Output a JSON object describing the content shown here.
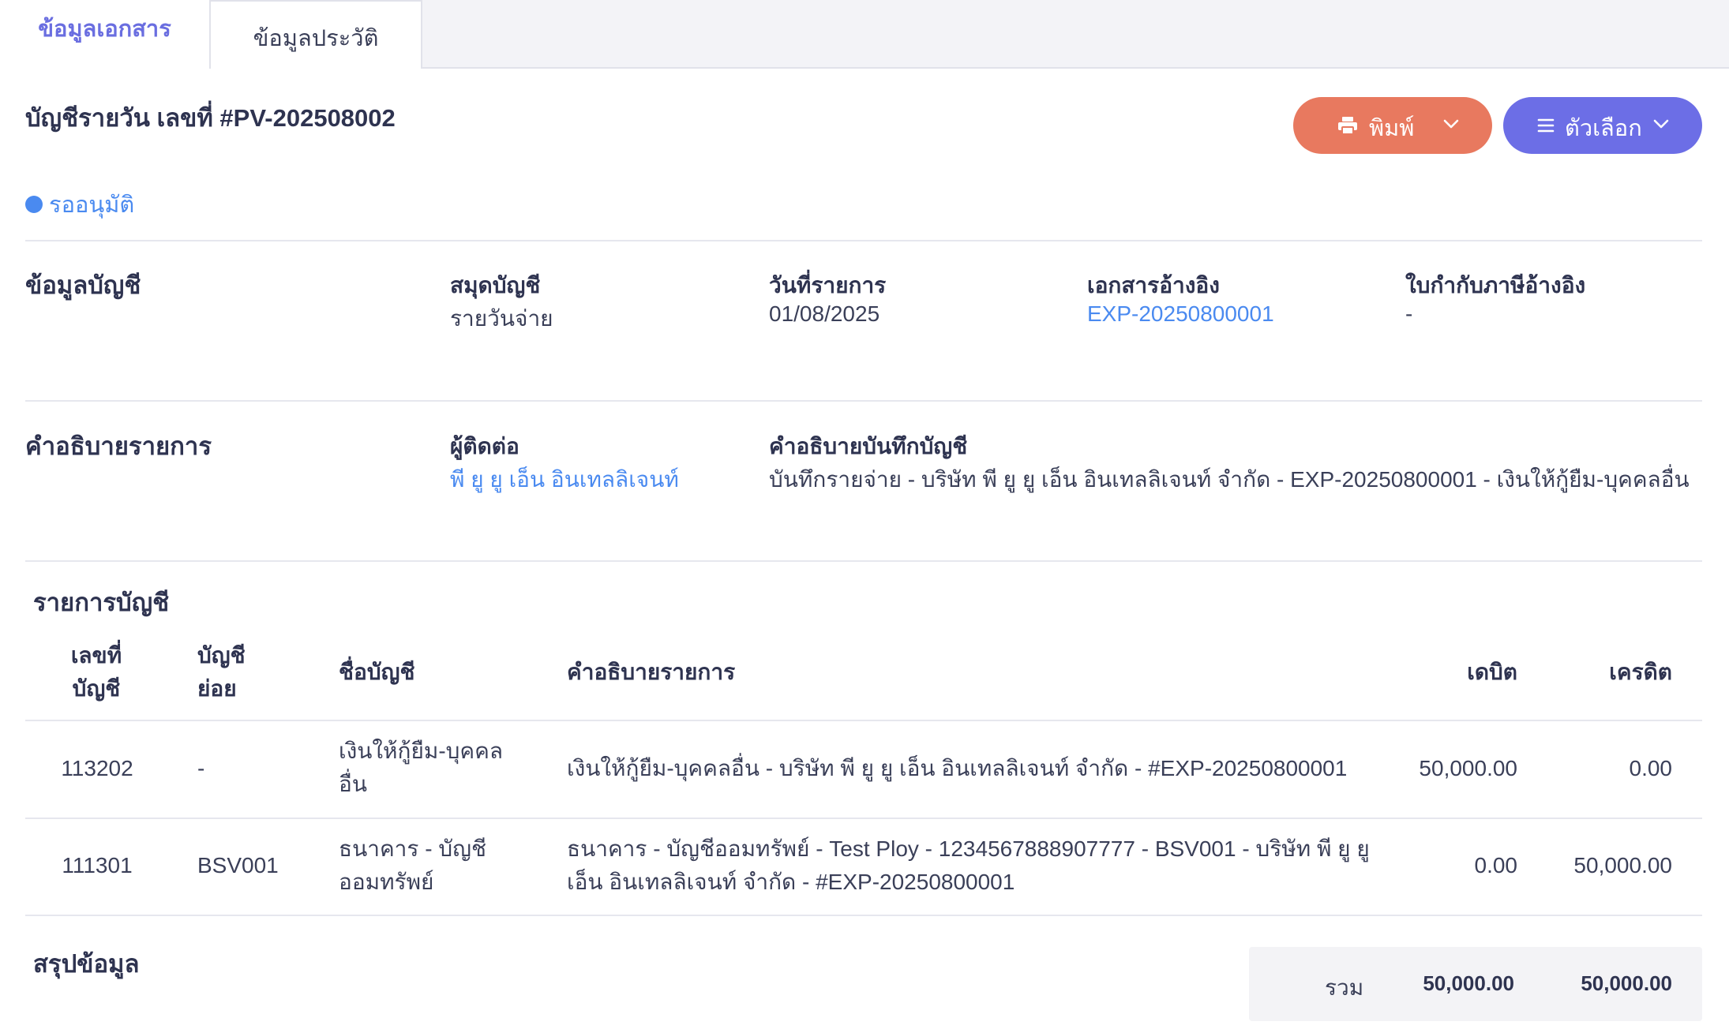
{
  "tabs": [
    {
      "label": "ข้อมูลเอกสาร",
      "active": true
    },
    {
      "label": "ข้อมูลประวัติ",
      "active": false
    }
  ],
  "document": {
    "title": "บัญชีรายวัน เลขที่ #PV-202508002",
    "status": "รออนุมัติ"
  },
  "actions": {
    "print_label": "พิมพ์",
    "options_label": "ตัวเลือก"
  },
  "account_info": {
    "section_title": "ข้อมูลบัญชี",
    "journal_label": "สมุดบัญชี",
    "journal_value": "รายวันจ่าย",
    "date_label": "วันที่รายการ",
    "date_value": "01/08/2025",
    "ref_doc_label": "เอกสารอ้างอิง",
    "ref_doc_value": "EXP-20250800001",
    "tax_ref_label": "ใบกำกับภาษีอ้างอิง",
    "tax_ref_value": "-"
  },
  "description": {
    "section_title": "คำอธิบายรายการ",
    "contact_label": "ผู้ติดต่อ",
    "contact_value": "พี ยู ยู เอ็น อินเทลลิเจนท์",
    "note_label": "คำอธิบายบันทึกบัญชี",
    "note_value": "บันทึกรายจ่าย - บริษัท พี ยู ยู เอ็น อินเทลลิเจนท์ จำกัด - EXP-20250800001 - เงินให้กู้ยืม-บุคคลอื่น"
  },
  "entries": {
    "section_title": "รายการบัญชี",
    "headers": {
      "acc_no_1": "เลขที่",
      "acc_no_2": "บัญชี",
      "sub_1": "บัญชี",
      "sub_2": "ย่อย",
      "name": "ชื่อบัญชี",
      "desc": "คำอธิบายรายการ",
      "debit": "เดบิต",
      "credit": "เครดิต"
    },
    "rows": [
      {
        "acc_no": "113202",
        "sub": "-",
        "name_1": "เงินให้กู้ยืม-บุคคล",
        "name_2": "อื่น",
        "desc_1": "เงินให้กู้ยืม-บุคคลอื่น - บริษัท พี ยู ยู เอ็น อินเทลลิเจนท์ จำกัด - #EXP-20250800001",
        "desc_2": "",
        "debit": "50,000.00",
        "credit": "0.00"
      },
      {
        "acc_no": "111301",
        "sub": "BSV001",
        "name_1": "ธนาคาร - บัญชี",
        "name_2": "ออมทรัพย์",
        "desc_1": "ธนาคาร - บัญชีออมทรัพย์ - Test Ploy - 1234567888907777 - BSV001 - บริษัท พี ยู ยู",
        "desc_2": "เอ็น อินเทลลิเจนท์ จำกัด - #EXP-20250800001",
        "debit": "0.00",
        "credit": "50,000.00"
      }
    ]
  },
  "summary": {
    "section_title": "สรุปข้อมูล",
    "total_label": "รวม",
    "total_debit": "50,000.00",
    "total_credit": "50,000.00"
  },
  "colors": {
    "accent": "#6c6ee6",
    "print_button": "#e8795f",
    "link": "#4a8af0",
    "status": "#4a8af0"
  }
}
